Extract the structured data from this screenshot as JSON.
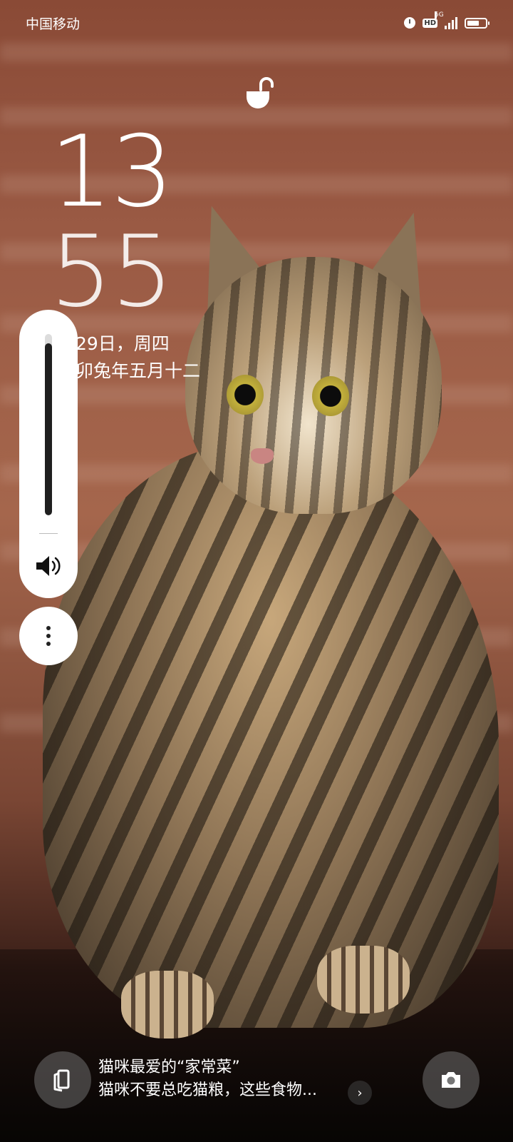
{
  "status_bar": {
    "carrier": "中国移动",
    "hd_label": "HD",
    "network_label": "5G",
    "battery_level": 0.7,
    "icons": [
      "alarm-icon",
      "hd-icon",
      "signal-icon",
      "battery-icon"
    ]
  },
  "lock": {
    "icon": "unlock-icon"
  },
  "clock": {
    "hours": "13",
    "minutes": "55",
    "date": "29日，周四",
    "lunar": "卯兔年五月十二"
  },
  "volume": {
    "level": 0.95,
    "icon": "speaker-icon",
    "more_icon": "more-vertical-icon"
  },
  "bottom": {
    "left_icon": "magazine-icon",
    "notification_title": "猫咪最爱的“家常菜”",
    "notification_subtitle": "猫咪不要总吃猫粮，这些食物...",
    "chevron": "›",
    "right_icon": "camera-icon"
  }
}
